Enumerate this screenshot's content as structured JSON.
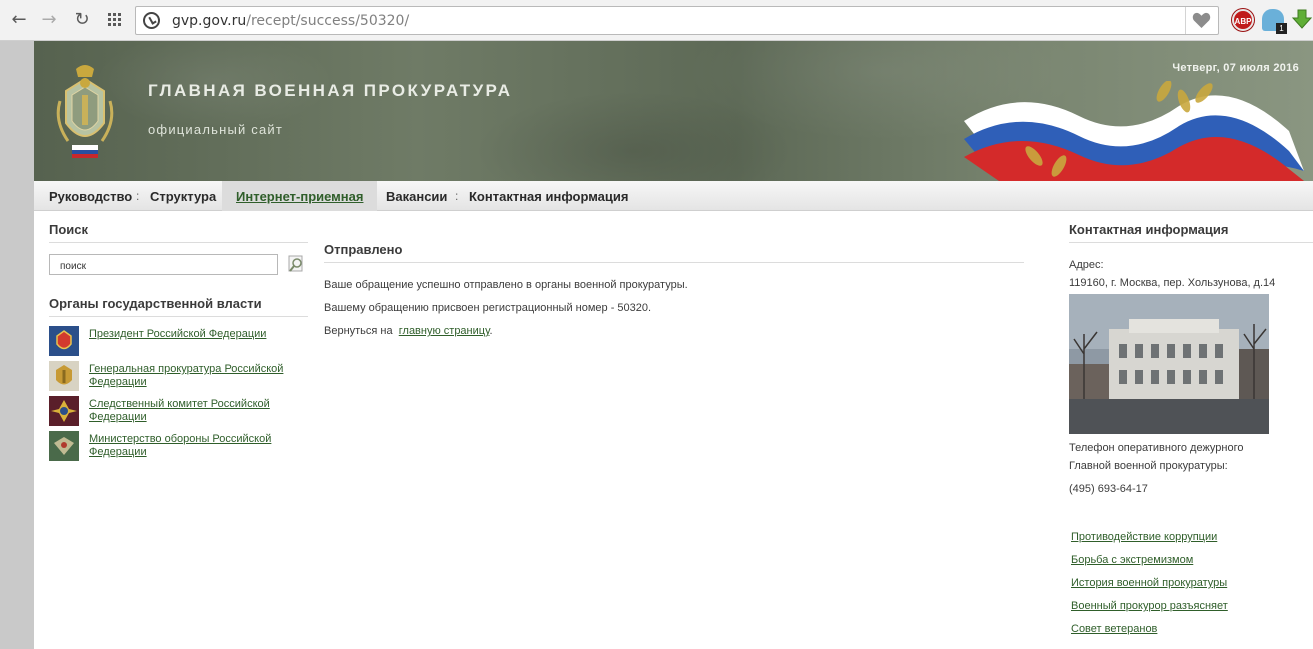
{
  "browser": {
    "url_domain": "gvp.gov.ru",
    "url_path": "/recept/success/50320/",
    "extensions": {
      "adblock_label": "ABP",
      "ghost_badge": "1"
    }
  },
  "header": {
    "title": "ГЛАВНАЯ ВОЕННАЯ ПРОКУРАТУРА",
    "subtitle": "официальный сайт",
    "date": "Четверг, 07 июля 2016"
  },
  "menu": {
    "items": [
      {
        "label": "Руководство"
      },
      {
        "label": "Структура"
      },
      {
        "label": "Интернет-приемная",
        "active": true
      },
      {
        "label": "Вакансии"
      },
      {
        "label": "Контактная информация"
      }
    ],
    "separator": ":"
  },
  "left": {
    "search_title": "Поиск",
    "search_value": "поиск",
    "orgs_title": "Органы государственной власти",
    "orgs": [
      {
        "label": "Президент Российской Федерации"
      },
      {
        "label": "Генеральная прокуратура Российской Федерации"
      },
      {
        "label": "Следственный комитет Российской Федерации"
      },
      {
        "label": "Министерство обороны Российской Федерации"
      }
    ]
  },
  "main": {
    "title": "Отправлено",
    "line1": "Ваше обращение успешно отправлено в органы военной прокуратуры.",
    "line2": "Вашему обращению присвоен регистрационный номер - 50320.",
    "return_prefix": "Вернуться на",
    "return_link": "главную страницу",
    "return_suffix": "."
  },
  "right": {
    "title": "Контактная информация",
    "address_label": "Адрес:",
    "address": "119160, г. Москва, пер. Хользунова, д.14",
    "phone_label_1": "Телефон оперативного дежурного",
    "phone_label_2": "Главной военной прокуратуры:",
    "phone": "(495) 693-64-17",
    "links": [
      {
        "label": "Противодействие коррупции"
      },
      {
        "label": "Борьба с экстремизмом"
      },
      {
        "label": "История военной прокуратуры"
      },
      {
        "label": "Военный прокурор разъясняет"
      },
      {
        "label": "Совет ветеранов"
      }
    ]
  },
  "colors": {
    "link": "#2f5e2a",
    "banner": "#6f7b66",
    "menu": "#e9e9e9"
  }
}
